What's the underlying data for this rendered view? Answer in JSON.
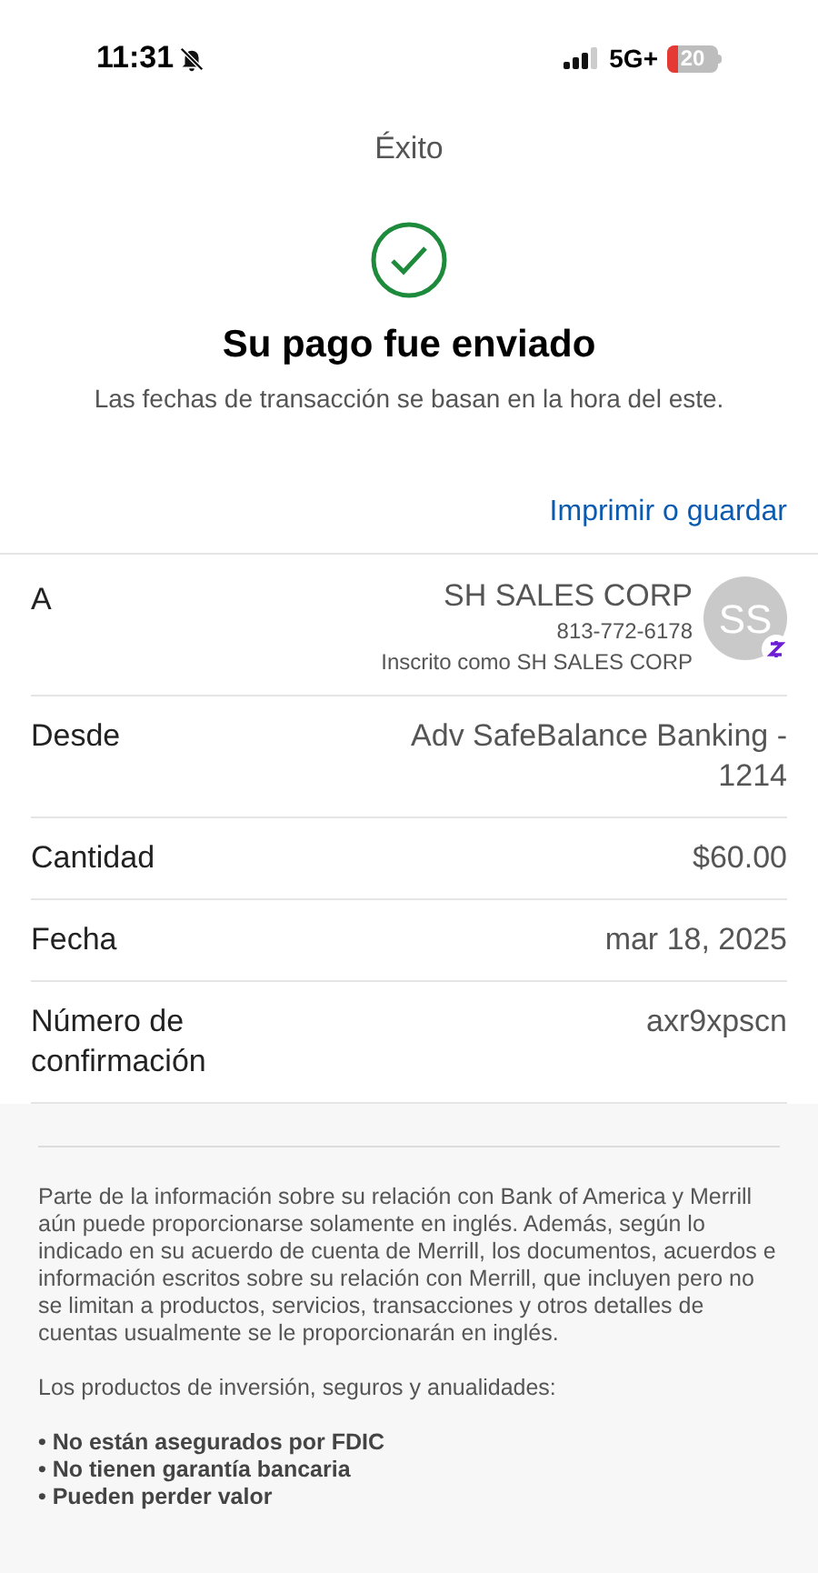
{
  "status_bar": {
    "time": "11:31",
    "network": "5G+",
    "battery": "20"
  },
  "title": "Éxito",
  "heading": "Su pago fue enviado",
  "subtitle": "Las fechas de transacción se basan en la hora del este.",
  "print_link": "Imprimir o guardar",
  "rows": [
    {
      "kind": "recipient",
      "label": "A",
      "name": "SH SALES CORP",
      "phone": "813-772-6178",
      "enrolled": "Inscrito como SH SALES CORP",
      "initials": "SS"
    },
    {
      "kind": "detail",
      "label": "Desde",
      "value": "Adv SafeBalance Banking - 1214"
    },
    {
      "kind": "detail",
      "label": "Cantidad",
      "value": "$60.00"
    },
    {
      "kind": "detail",
      "label": "Fecha",
      "value": "mar 18, 2025"
    },
    {
      "kind": "detail",
      "label": "Número de confirmación",
      "value": "axr9xpscn"
    }
  ],
  "disclosure": "Parte de la información sobre su relación con Bank of America y Merrill aún puede proporcionarse solamente en inglés. Además, según lo indicado en su acuerdo de cuenta de Merrill, los documentos, acuerdos e información escritos sobre su relación con Merrill, que incluyen pero no se limitan a productos, servicios, transacciones y otros detalles de cuentas usualmente se le proporcionarán en inglés.",
  "investment_intro": "Los productos de inversión, seguros y anualidades:",
  "investment_points": [
    "• No están asegurados por FDIC",
    "• No tienen garantía bancaria",
    "• Pueden perder valor"
  ]
}
